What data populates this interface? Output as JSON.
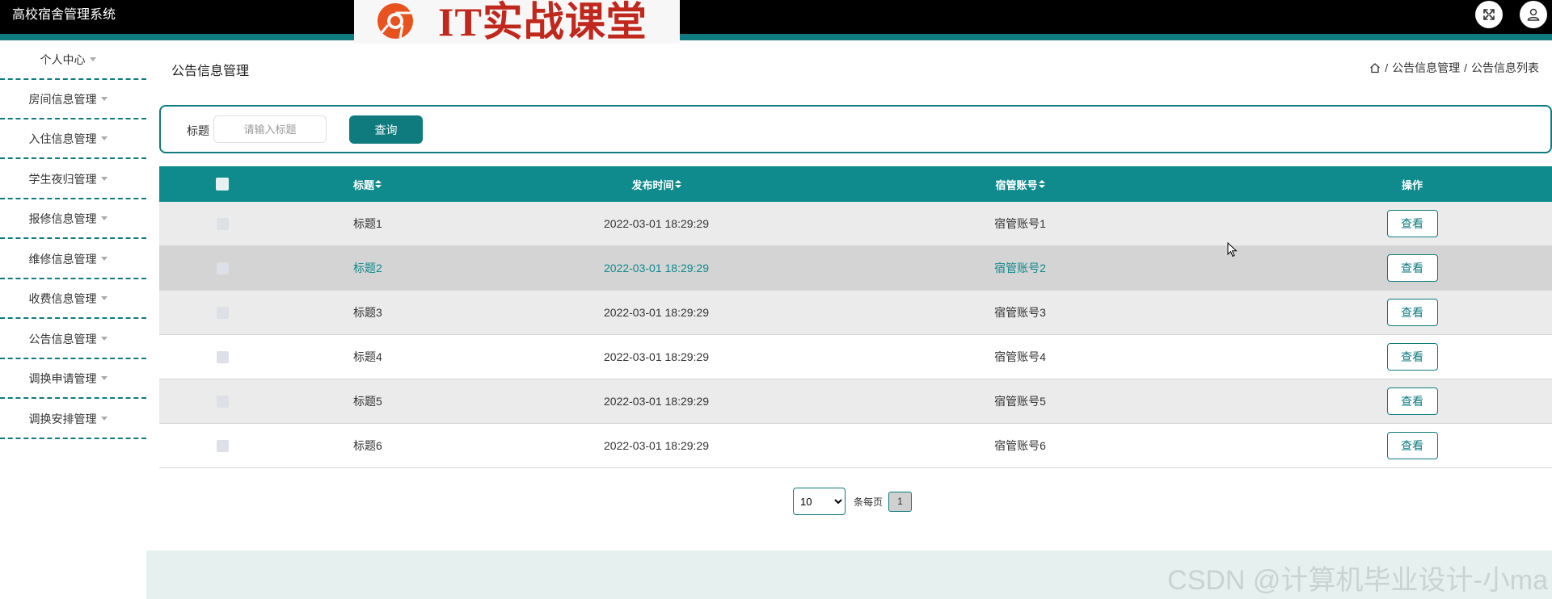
{
  "header": {
    "app_title": "高校宿舍管理系统",
    "logo_text": "IT实战课堂",
    "fullscreen_icon": "expand-icon",
    "user_icon": "user-icon",
    "accent_color": "#0f7b7f"
  },
  "sidebar": {
    "items": [
      {
        "label": "个人中心"
      },
      {
        "label": "房间信息管理"
      },
      {
        "label": "入住信息管理"
      },
      {
        "label": "学生夜归管理"
      },
      {
        "label": "报修信息管理"
      },
      {
        "label": "维修信息管理"
      },
      {
        "label": "收费信息管理"
      },
      {
        "label": "公告信息管理"
      },
      {
        "label": "调换申请管理"
      },
      {
        "label": "调换安排管理"
      }
    ]
  },
  "main": {
    "page_title": "公告信息管理",
    "breadcrumb": [
      "公告信息管理",
      "公告信息列表"
    ],
    "search": {
      "label": "标题",
      "placeholder": "请输入标题",
      "button": "查询"
    },
    "table": {
      "headers": {
        "title": "标题",
        "time": "发布时间",
        "account": "宿管账号",
        "op": "操作"
      },
      "rows": [
        {
          "title": "标题1",
          "time": "2022-03-01 18:29:29",
          "account": "宿管账号1",
          "action": "查看"
        },
        {
          "title": "标题2",
          "time": "2022-03-01 18:29:29",
          "account": "宿管账号2",
          "action": "查看"
        },
        {
          "title": "标题3",
          "time": "2022-03-01 18:29:29",
          "account": "宿管账号3",
          "action": "查看"
        },
        {
          "title": "标题4",
          "time": "2022-03-01 18:29:29",
          "account": "宿管账号4",
          "action": "查看"
        },
        {
          "title": "标题5",
          "time": "2022-03-01 18:29:29",
          "account": "宿管账号5",
          "action": "查看"
        },
        {
          "title": "标题6",
          "time": "2022-03-01 18:29:29",
          "account": "宿管账号6",
          "action": "查看"
        }
      ]
    },
    "pagination": {
      "page_size": "10",
      "per_page_label": "条每页",
      "current_page": "1"
    },
    "watermark": "CSDN @计算机毕业设计-小ma"
  }
}
